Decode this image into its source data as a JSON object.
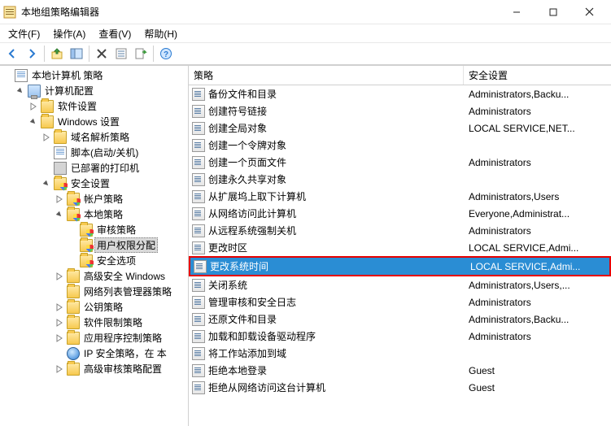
{
  "window": {
    "title": "本地组策略编辑器"
  },
  "menu": {
    "file": "文件(F)",
    "action": "操作(A)",
    "view": "查看(V)",
    "help": "帮助(H)"
  },
  "tree": {
    "root": "本地计算机 策略",
    "computer_config": "计算机配置",
    "software_settings": "软件设置",
    "windows_settings": "Windows 设置",
    "dns_policy": "域名解析策略",
    "scripts": "脚本(启动/关机)",
    "deployed_printers": "已部署的打印机",
    "security_settings": "安全设置",
    "account_policies": "帐户策略",
    "local_policies": "本地策略",
    "audit_policy": "审核策略",
    "user_rights": "用户权限分配",
    "security_options": "安全选项",
    "advanced_firewall": "高级安全 Windows",
    "network_list": "网络列表管理器策略",
    "public_key": "公钥策略",
    "software_restrict": "软件限制策略",
    "app_control": "应用程序控制策略",
    "ip_security": "IP 安全策略，在 本",
    "advanced_audit": "高级审核策略配置"
  },
  "list": {
    "header_policy": "策略",
    "header_security": "安全设置",
    "rows": [
      {
        "name": "备份文件和目录",
        "setting": "Administrators,Backu..."
      },
      {
        "name": "创建符号链接",
        "setting": "Administrators"
      },
      {
        "name": "创建全局对象",
        "setting": "LOCAL SERVICE,NET..."
      },
      {
        "name": "创建一个令牌对象",
        "setting": ""
      },
      {
        "name": "创建一个页面文件",
        "setting": "Administrators"
      },
      {
        "name": "创建永久共享对象",
        "setting": ""
      },
      {
        "name": "从扩展坞上取下计算机",
        "setting": "Administrators,Users"
      },
      {
        "name": "从网络访问此计算机",
        "setting": "Everyone,Administrat..."
      },
      {
        "name": "从远程系统强制关机",
        "setting": "Administrators"
      },
      {
        "name": "更改时区",
        "setting": "LOCAL SERVICE,Admi..."
      },
      {
        "name": "更改系统时间",
        "setting": "LOCAL SERVICE,Admi...",
        "selected": true,
        "highlight": true
      },
      {
        "name": "关闭系统",
        "setting": "Administrators,Users,..."
      },
      {
        "name": "管理审核和安全日志",
        "setting": "Administrators"
      },
      {
        "name": "还原文件和目录",
        "setting": "Administrators,Backu..."
      },
      {
        "name": "加载和卸载设备驱动程序",
        "setting": "Administrators"
      },
      {
        "name": "将工作站添加到域",
        "setting": ""
      },
      {
        "name": "拒绝本地登录",
        "setting": "Guest"
      },
      {
        "name": "拒绝从网络访问这台计算机",
        "setting": "Guest"
      }
    ]
  }
}
